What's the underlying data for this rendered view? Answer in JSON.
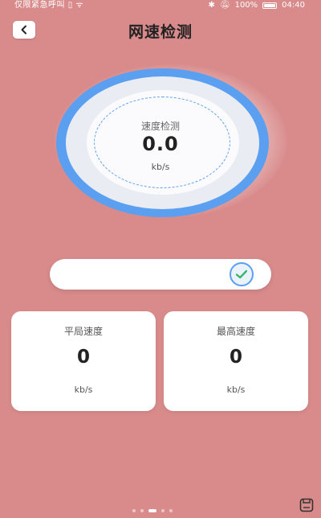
{
  "status_bar": {
    "left_text": "仅限紧急呼叫",
    "battery_text": "100%",
    "time": "04:40"
  },
  "header": {
    "title": "网速检测"
  },
  "gauge": {
    "label": "速度检测",
    "value": "0.0",
    "unit": "kb/s"
  },
  "progress": {
    "fraction": 0.0,
    "status": "complete"
  },
  "stats": {
    "average": {
      "label": "平局速度",
      "value": "0",
      "unit": "kb/s"
    },
    "max": {
      "label": "最高速度",
      "value": "0",
      "unit": "kb/s"
    }
  },
  "pager": {
    "count": 5,
    "active_index": 2
  },
  "colors": {
    "background": "#d98b8b",
    "accent": "#5b9ff0",
    "check": "#3bb56b"
  },
  "icons": {
    "back": "chevron-left-icon",
    "check": "check-icon",
    "save": "save-icon",
    "bluetooth": "bluetooth-icon",
    "mute": "mute-icon",
    "wifi": "wifi-icon",
    "battery": "battery-icon"
  }
}
